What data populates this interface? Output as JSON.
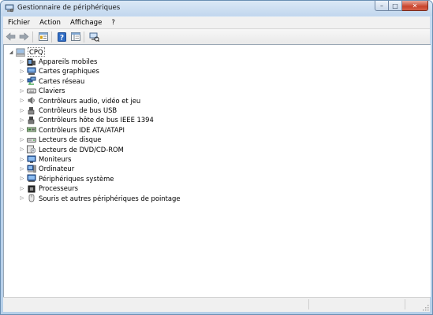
{
  "window": {
    "title": "Gestionnaire de périphériques"
  },
  "menu": [
    "Fichier",
    "Action",
    "Affichage",
    "?"
  ],
  "toolbar": {
    "icons": [
      "back-icon",
      "forward-icon",
      "properties-view-icon",
      "help-icon",
      "console-view-icon",
      "scan-hardware-icon"
    ]
  },
  "tree": {
    "root": "CPQ",
    "items": [
      "Appareils mobiles",
      "Cartes graphiques",
      "Cartes réseau",
      "Claviers",
      "Contrôleurs audio, vidéo et jeu",
      "Contrôleurs de bus USB",
      "Contrôleurs hôte de bus IEEE 1394",
      "Contrôleurs IDE ATA/ATAPI",
      "Lecteurs de disque",
      "Lecteurs de DVD/CD-ROM",
      "Moniteurs",
      "Ordinateur",
      "Périphériques système",
      "Processeurs",
      "Souris et autres périphériques de pointage"
    ]
  }
}
